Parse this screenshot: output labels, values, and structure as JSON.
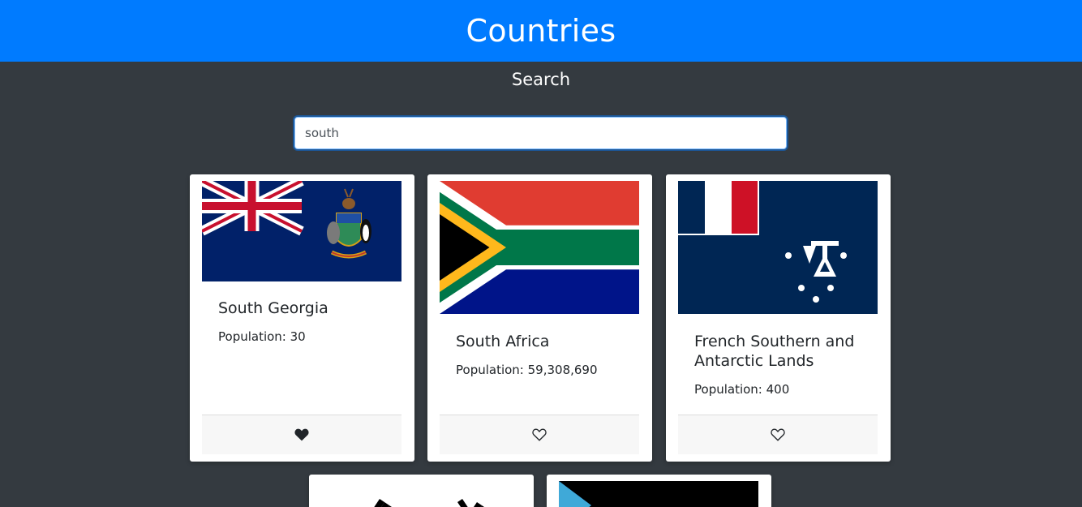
{
  "header": {
    "title": "Countries"
  },
  "search": {
    "title": "Search",
    "value": "south"
  },
  "cards": [
    {
      "name": "South Georgia",
      "population_label": "Population: 30",
      "favorite": true
    },
    {
      "name": "South Africa",
      "population_label": "Population: 59,308,690",
      "favorite": false
    },
    {
      "name": "French Southern and Antarctic Lands",
      "population_label": "Population: 400",
      "favorite": false
    }
  ],
  "colors": {
    "header": "#007bff",
    "background": "#343a40",
    "card": "#ffffff"
  },
  "icons": {
    "favorite_filled": "heart-filled-icon",
    "favorite_outline": "heart-outline-icon"
  }
}
